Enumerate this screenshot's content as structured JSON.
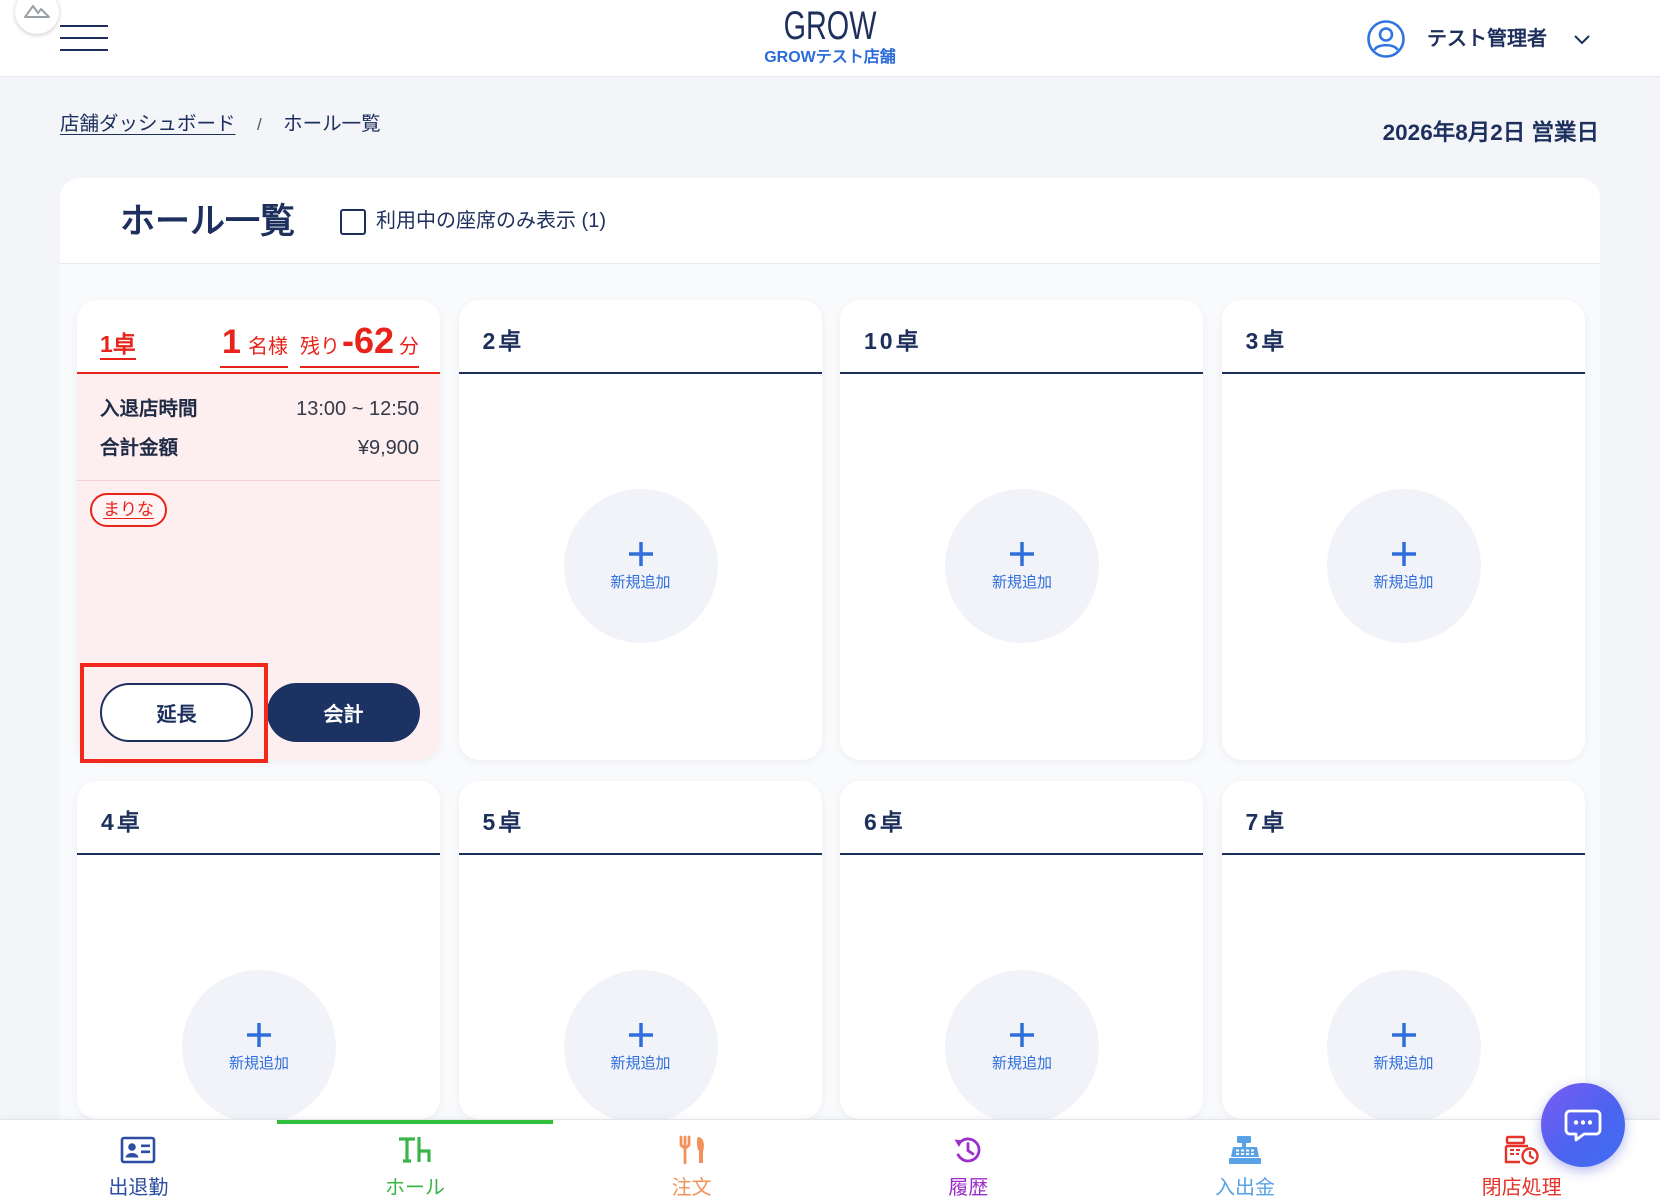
{
  "header": {
    "logo_title": "GROW",
    "store_name": "GROWテスト店舗",
    "user_name": "テスト管理者"
  },
  "breadcrumb": {
    "items": [
      "店舗ダッシュボード",
      "ホール一覧"
    ],
    "separator": "/"
  },
  "business_date": "2026年8月2日 営業日",
  "hall": {
    "title": "ホール一覧",
    "filter_label": "利用中の座席のみ表示 (1)",
    "filter_checked": false,
    "add_label": "新規追加"
  },
  "tables": [
    {
      "name": "1卓",
      "occupied": true,
      "guests": "1",
      "guests_unit": "名様",
      "remaining_label": "残り",
      "remaining_minutes": "-62",
      "remaining_unit": "分",
      "stay_time_label": "入退店時間",
      "stay_time": "13:00 ~ 12:50",
      "total_label": "合計金額",
      "total": "¥9,900",
      "cast_tag": "まりな",
      "extend_label": "延長",
      "checkout_label": "会計"
    },
    {
      "name": "2卓",
      "occupied": false
    },
    {
      "name": "10卓",
      "occupied": false
    },
    {
      "name": "3卓",
      "occupied": false
    },
    {
      "name": "4卓",
      "occupied": false
    },
    {
      "name": "5卓",
      "occupied": false
    },
    {
      "name": "6卓",
      "occupied": false
    },
    {
      "name": "7卓",
      "occupied": false
    }
  ],
  "nav": [
    {
      "label": "出退勤",
      "icon": "id-card-icon",
      "color": "#2d4da3",
      "active": false
    },
    {
      "label": "ホール",
      "icon": "hall-table-icon",
      "color": "#3bb54a",
      "active": true
    },
    {
      "label": "注文",
      "icon": "fork-knife-icon",
      "color": "#f2925a",
      "active": false
    },
    {
      "label": "履歴",
      "icon": "history-icon",
      "color": "#9c2fc9",
      "active": false
    },
    {
      "label": "入出金",
      "icon": "cash-register-icon",
      "color": "#5aa2e6",
      "active": false
    },
    {
      "label": "閉店処理",
      "icon": "close-register-icon",
      "color": "#e6332a",
      "active": false
    }
  ],
  "colors": {
    "navy": "#1d2f5c",
    "accent_blue": "#2f6fdb",
    "occupied_red": "#e8231a",
    "occupied_bg": "#fdeef0",
    "highlight_red": "#f02b1e",
    "chat_button": "#4c63f0"
  }
}
